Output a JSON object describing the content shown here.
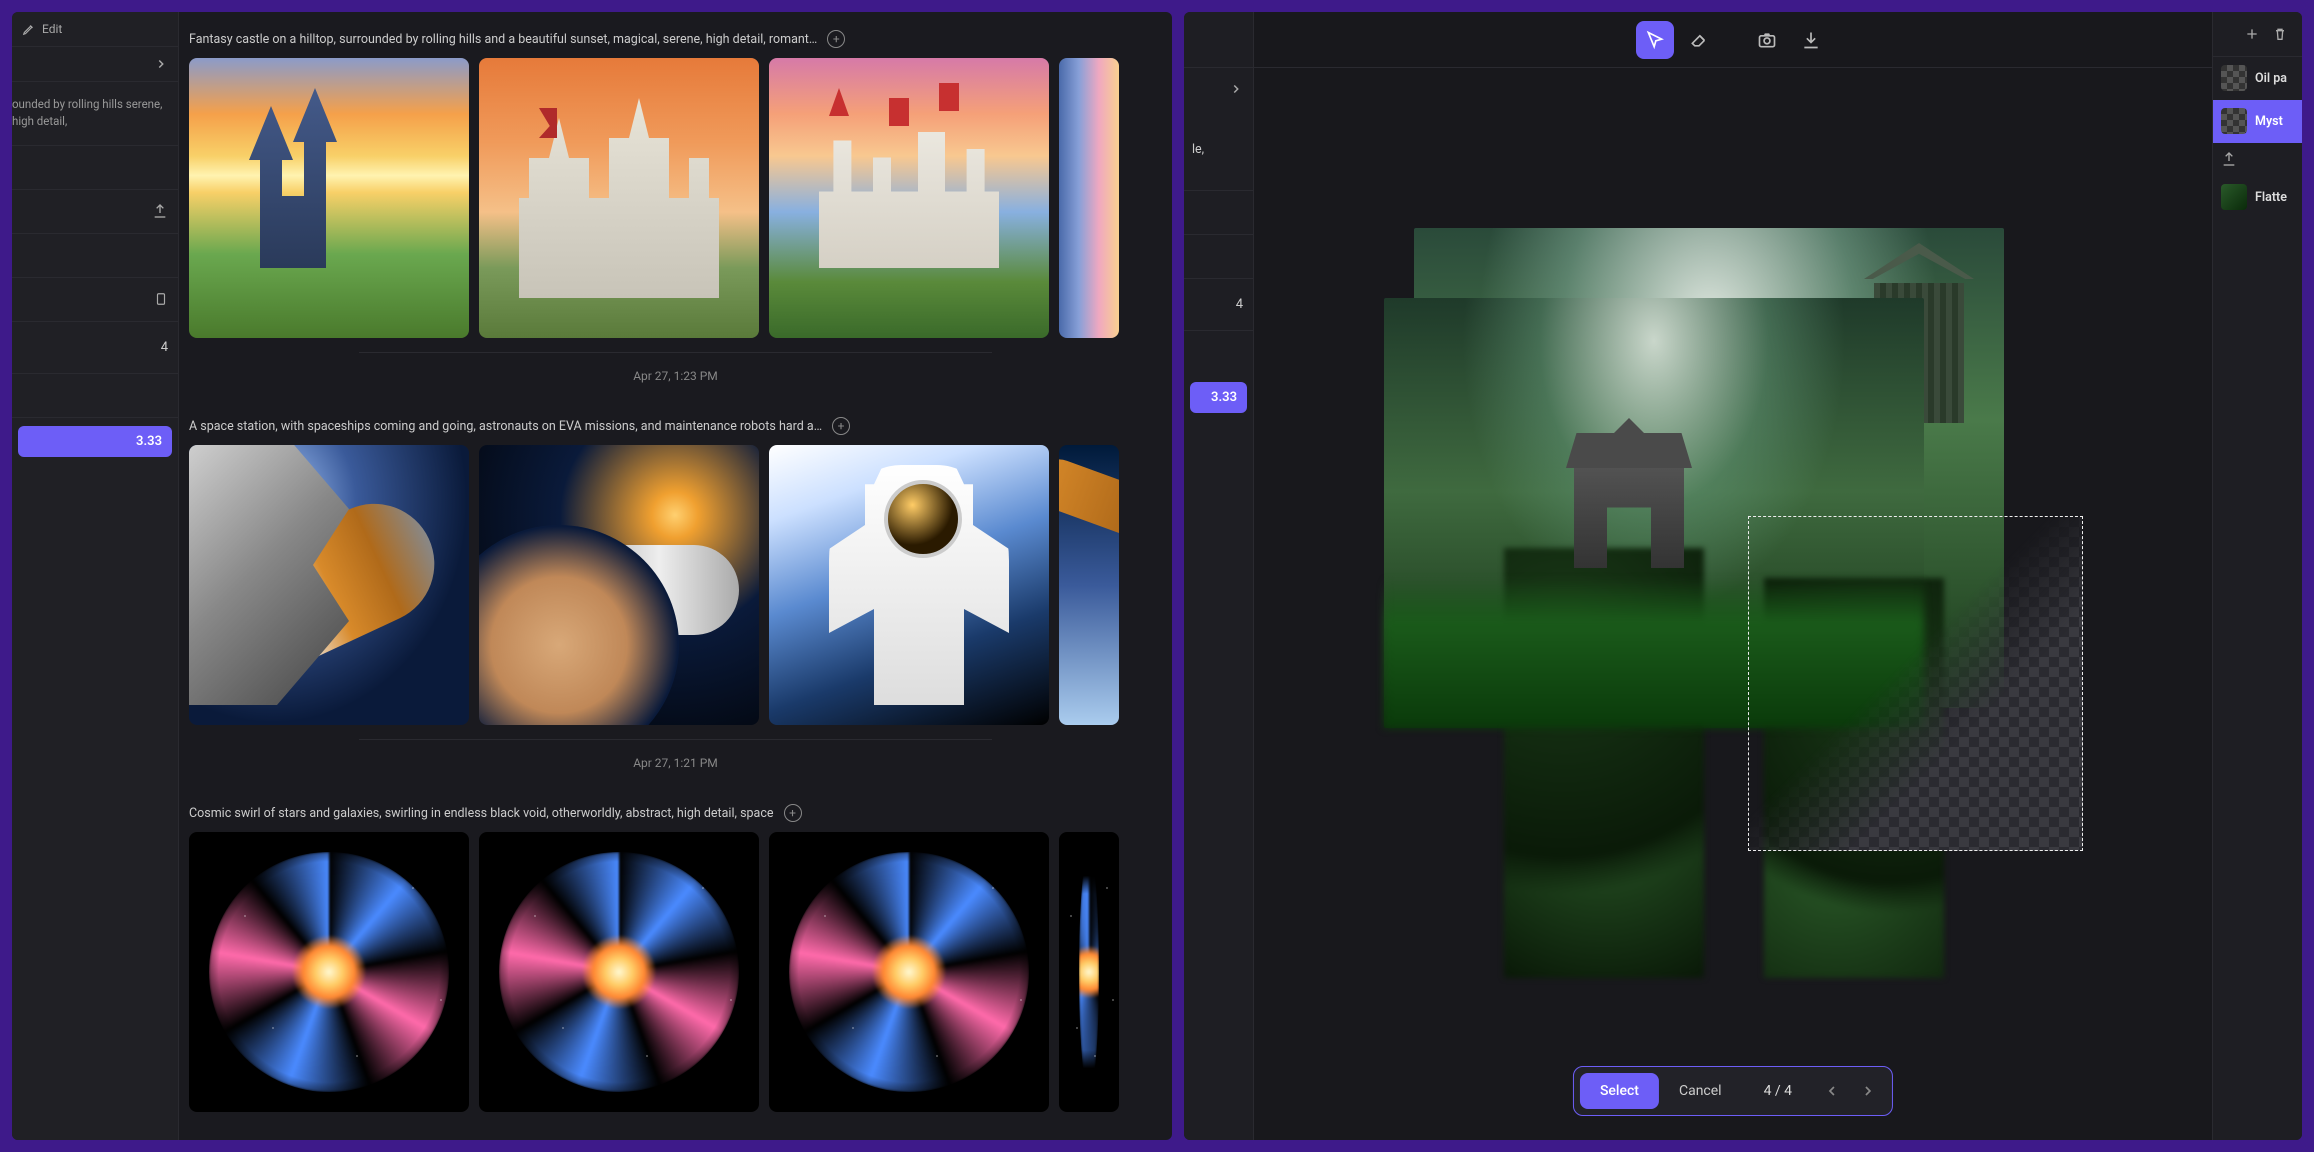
{
  "left_sidebar": {
    "edit_label": "Edit",
    "prompt_snippet": "ounded by rolling hills serene, high detail,",
    "count": "4",
    "cost": "3.33"
  },
  "generations": [
    {
      "prompt": "Fantasy castle on a hilltop, surrounded by rolling hills and a beautiful sunset, magical, serene, high detail, romant…",
      "timestamp": "Apr 27, 1:23 PM",
      "thumbs": [
        "castle1",
        "castle2",
        "castle3",
        "castle4"
      ]
    },
    {
      "prompt": "A space station, with spaceships coming and going, astronauts on EVA missions, and maintenance robots hard a…",
      "timestamp": "Apr 27, 1:21 PM",
      "thumbs": [
        "space1",
        "space2",
        "space3",
        "space4"
      ]
    },
    {
      "prompt": "Cosmic swirl of stars and galaxies, swirling in endless black void, otherworldly, abstract, high detail, space",
      "timestamp": "",
      "thumbs": [
        "galaxy",
        "galaxy",
        "galaxy",
        "galaxy"
      ]
    }
  ],
  "right_sidebar": {
    "text_snippet": "le,",
    "count": "4",
    "cost": "3.33"
  },
  "canvas": {
    "select_label": "Select",
    "cancel_label": "Cancel",
    "counter": "4 / 4"
  },
  "layers": {
    "items": [
      {
        "label": "Oil pa",
        "type": "checker"
      },
      {
        "label": "Myst",
        "type": "checker",
        "selected": true
      },
      {
        "label": "",
        "type": "upload"
      },
      {
        "label": "Flatte",
        "type": "img"
      }
    ]
  }
}
